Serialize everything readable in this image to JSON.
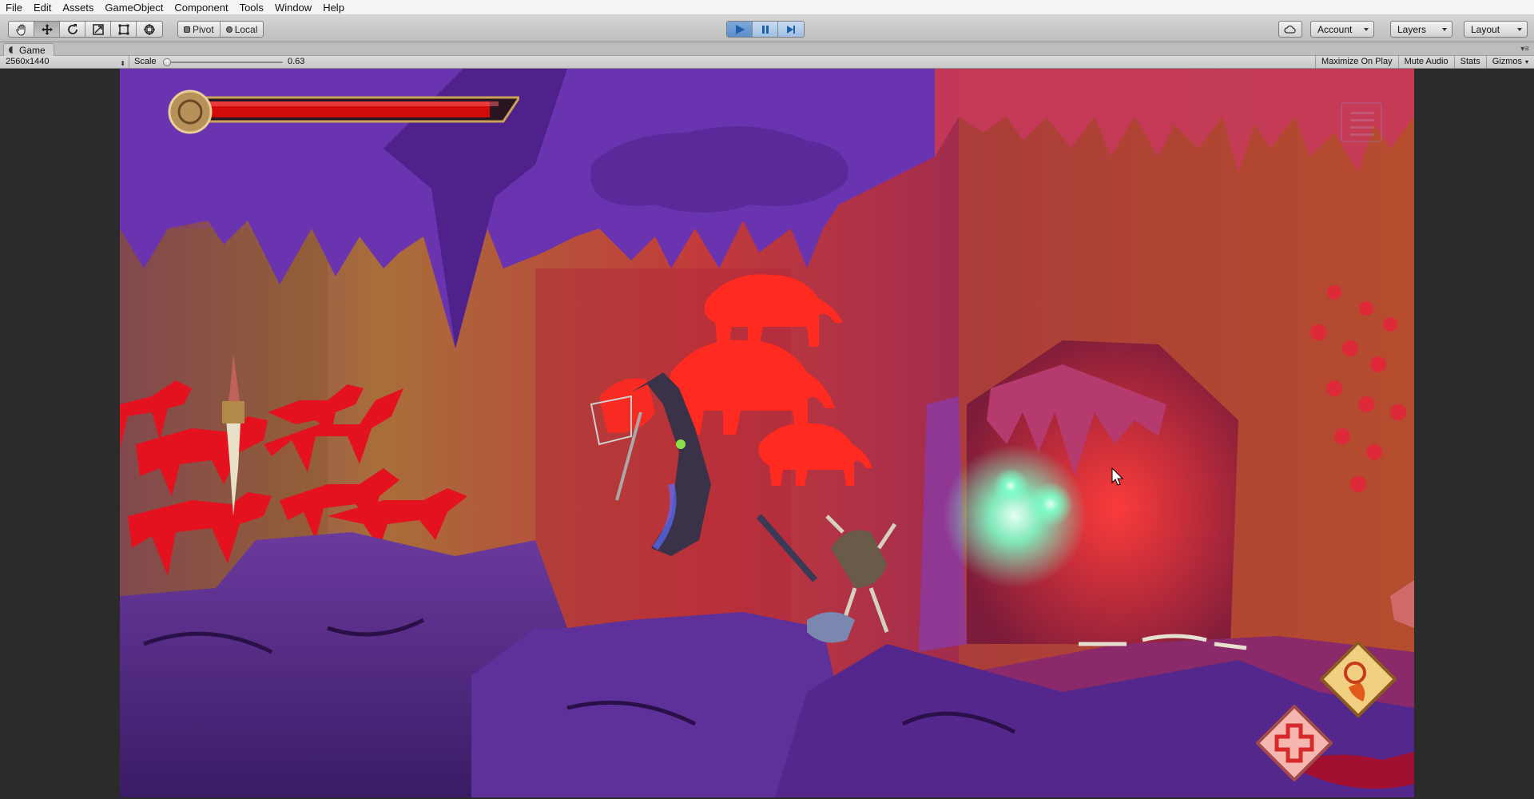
{
  "menu": {
    "items": [
      "File",
      "Edit",
      "Assets",
      "GameObject",
      "Component",
      "Tools",
      "Window",
      "Help"
    ]
  },
  "toolbar": {
    "tools": [
      "hand-icon",
      "move-icon",
      "rotate-icon",
      "scale-icon",
      "rect-icon",
      "transform-icon"
    ],
    "active_tool_index": 1,
    "pivot_label": "Pivot",
    "local_label": "Local",
    "play_state": "playing",
    "account_label": "Account",
    "layers_label": "Layers",
    "layout_label": "Layout"
  },
  "tab": {
    "title": "Game"
  },
  "game_view": {
    "resolution": "2560x1440",
    "scale_label": "Scale",
    "scale_value": "0.63",
    "maximize_label": "Maximize On Play",
    "mute_label": "Mute Audio",
    "stats_label": "Stats",
    "gizmos_label": "Gizmos"
  },
  "hud": {
    "health_fraction": 0.97,
    "health_color": "#d10a0a",
    "skill_fire_icon": "fire-spiral-icon",
    "skill_heal_icon": "heal-cross-icon"
  },
  "colors": {
    "cave_purple": "#5b2a8e",
    "cave_red": "#d8262a",
    "glow_green": "#7dffc8",
    "hud_gold": "#c9a25a"
  }
}
